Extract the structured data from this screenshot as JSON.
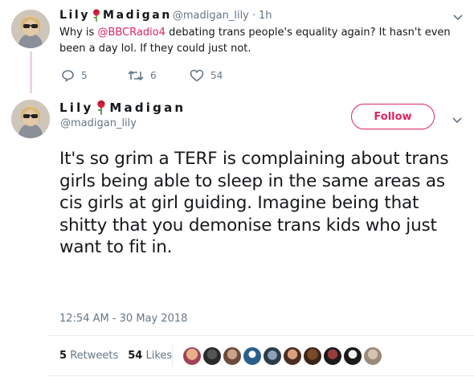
{
  "reply_tweet": {
    "author_name_start": "Lily",
    "author_name_end": "Madigan",
    "handle": "@madigan_lily",
    "separator": "·",
    "time": "1h",
    "text_before": "Why is ",
    "mention": "@BBCRadio4",
    "text_after": " debating trans people's equality again? It hasn't even been a day lol. If they could just not.",
    "reply_count": "5",
    "retweet_count": "6",
    "like_count": "54"
  },
  "main_tweet": {
    "author_name_start": "Lily",
    "author_name_end": "Madigan",
    "handle": "@madigan_lily",
    "follow_label": "Follow",
    "text": "It's so grim a TERF is complaining about trans girls being able to sleep in the same areas as cis girls at girl guiding. Imagine being that shitty that you demonise trans kids who just want to fit in.",
    "timestamp": "12:54 AM - 30 May 2018",
    "retweets_count": "5",
    "retweets_label": "Retweets",
    "likes_count": "54",
    "likes_label": "Likes"
  },
  "icons": {
    "reply": "reply-icon",
    "retweet": "retweet-icon",
    "like": "heart-icon",
    "rose": "rose-emoji-icon",
    "menu": "chevron-down-icon"
  },
  "colors": {
    "accent": "#e0245e",
    "muted": "#657786",
    "text": "#14171a",
    "thread_line": "#e8d6e8"
  }
}
